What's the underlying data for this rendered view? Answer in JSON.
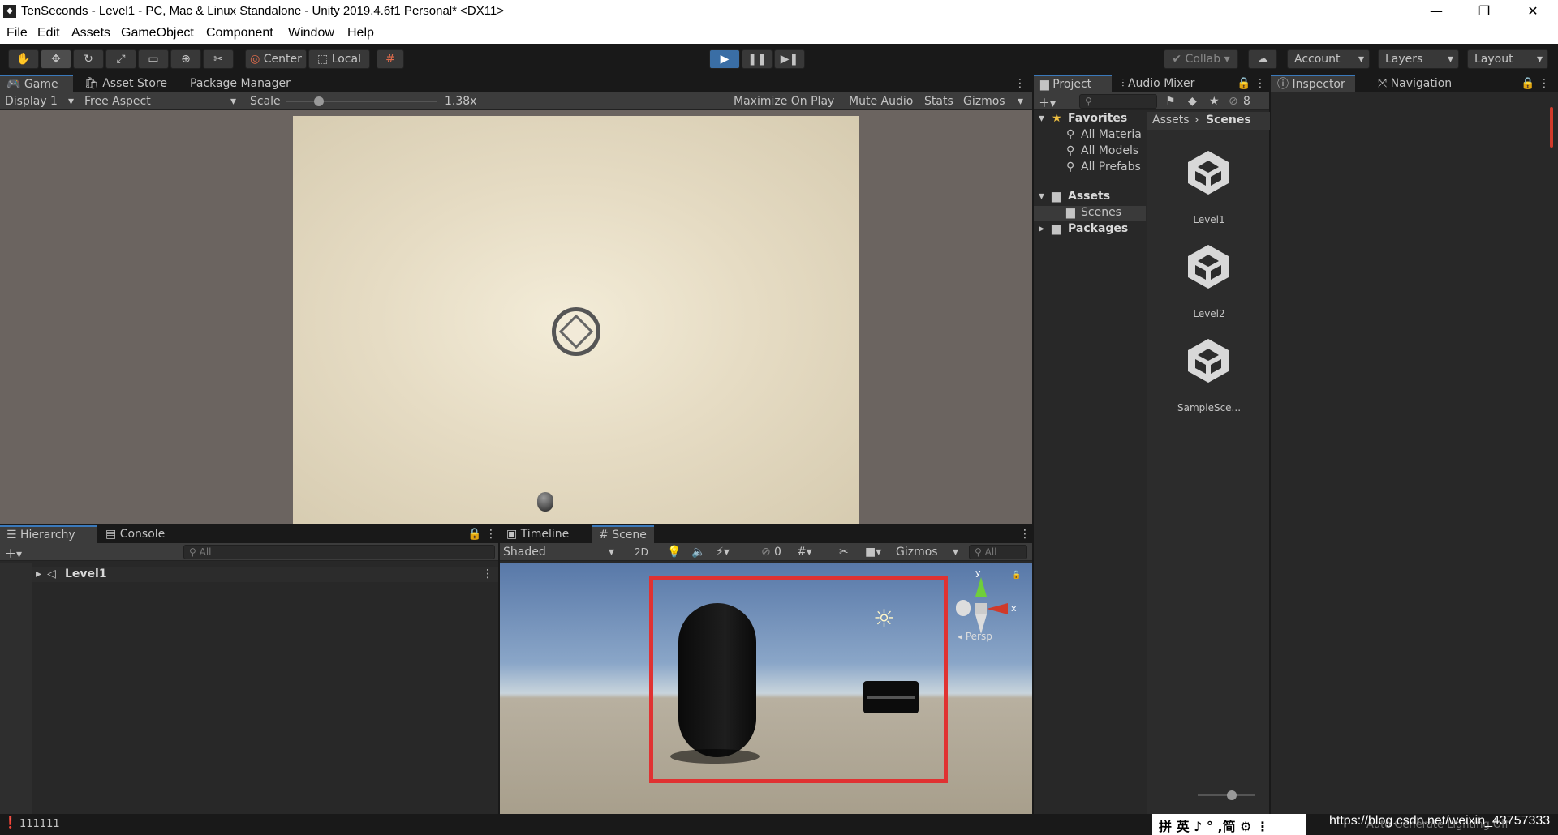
{
  "window": {
    "title": "TenSeconds - Level1 - PC, Mac & Linux Standalone - Unity 2019.4.6f1 Personal* <DX11>",
    "minimize": "—",
    "maximize": "❐",
    "close": "✕"
  },
  "menu": [
    "File",
    "Edit",
    "Assets",
    "GameObject",
    "Component",
    "Window",
    "Help"
  ],
  "toolbar": {
    "pivot": "Center",
    "space": "Local",
    "collab": "Collab",
    "account": "Account",
    "layers": "Layers",
    "layout": "Layout"
  },
  "game_panel": {
    "tabs": [
      "Game",
      "Asset Store",
      "Package Manager"
    ],
    "display": "Display 1",
    "aspect": "Free Aspect",
    "scale_label": "Scale",
    "scale_value": "1.38x",
    "scale_level": 0.22,
    "buttons": [
      "Maximize On Play",
      "Mute Audio",
      "Stats",
      "Gizmos"
    ]
  },
  "hierarchy": {
    "tabs": [
      "Hierarchy",
      "Console"
    ],
    "search_placeholder": "All",
    "root": "Level1"
  },
  "scene_panel": {
    "tabs": [
      "Timeline",
      "Scene"
    ],
    "shading": "Shaded",
    "mode2d": "2D",
    "hidden_count": "0",
    "gizmos": "Gizmos",
    "search_placeholder": "All",
    "axis_y": "y",
    "axis_x": "x",
    "persp": "Persp"
  },
  "project": {
    "tabs": [
      "Project",
      "Audio Mixer"
    ],
    "hidden_count": "8",
    "favorites": "Favorites",
    "fav_items": [
      "All Materia",
      "All Models",
      "All Prefabs"
    ],
    "assets": "Assets",
    "scenes": "Scenes",
    "packages": "Packages",
    "breadcrumb_root": "Assets",
    "breadcrumb_current": "Scenes",
    "files": [
      "Level1",
      "Level2",
      "SampleSce..."
    ]
  },
  "inspector": {
    "tabs": [
      "Inspector",
      "Navigation"
    ]
  },
  "status": {
    "message": "111111",
    "ime": "拼 英 ♪ ° ,简 ⚙ ⋮",
    "lighting": "Auto Generate Lighting Off",
    "watermark": "https://blog.csdn.net/weixin_43757333"
  }
}
